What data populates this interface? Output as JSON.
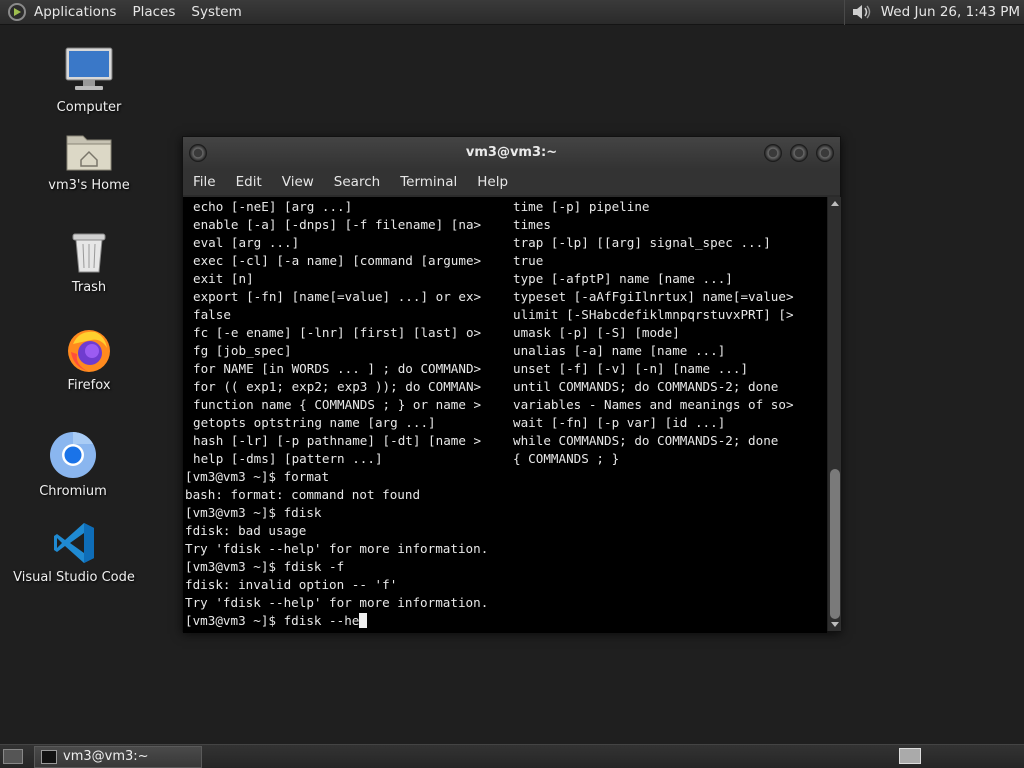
{
  "top_panel": {
    "menus": [
      "Applications",
      "Places",
      "System"
    ],
    "clock": "Wed Jun 26,  1:43 PM"
  },
  "desktop": {
    "icons": [
      {
        "label": "Computer",
        "icon": "computer-icon"
      },
      {
        "label": "vm3's Home",
        "icon": "home-folder-icon"
      },
      {
        "label": "Trash",
        "icon": "trash-icon"
      },
      {
        "label": "Firefox",
        "icon": "firefox-icon"
      },
      {
        "label": "Chromium",
        "icon": "chromium-icon"
      },
      {
        "label": "Visual Studio Code",
        "icon": "vscode-icon"
      }
    ]
  },
  "window": {
    "title": "vm3@vm3:~",
    "menus": [
      "File",
      "Edit",
      "View",
      "Search",
      "Terminal",
      "Help"
    ]
  },
  "terminal": {
    "left_column": [
      "echo [-neE] [arg ...]",
      "enable [-a] [-dnps] [-f filename] [na>",
      "eval [arg ...]",
      "exec [-cl] [-a name] [command [argume>",
      "exit [n]",
      "export [-fn] [name[=value] ...] or ex>",
      "false",
      "fc [-e ename] [-lnr] [first] [last] o>",
      "fg [job_spec]",
      "for NAME [in WORDS ... ] ; do COMMAND>",
      "for (( exp1; exp2; exp3 )); do COMMAN>",
      "function name { COMMANDS ; } or name >",
      "getopts optstring name [arg ...]",
      "hash [-lr] [-p pathname] [-dt] [name >",
      "help [-dms] [pattern ...]"
    ],
    "right_column": [
      "time [-p] pipeline",
      "times",
      "trap [-lp] [[arg] signal_spec ...]",
      "true",
      "type [-afptP] name [name ...]",
      "typeset [-aAfFgiIlnrtux] name[=value>",
      "ulimit [-SHabcdefiklmnpqrstuvxPRT] [>",
      "umask [-p] [-S] [mode]",
      "unalias [-a] name [name ...]",
      "unset [-f] [-v] [-n] [name ...]",
      "until COMMANDS; do COMMANDS-2; done",
      "variables - Names and meanings of so>",
      "wait [-fn] [-p var] [id ...]",
      "while COMMANDS; do COMMANDS-2; done",
      "{ COMMANDS ; }"
    ],
    "bottom_lines": [
      "[vm3@vm3 ~]$ format",
      "bash: format: command not found",
      "[vm3@vm3 ~]$ fdisk",
      "fdisk: bad usage",
      "Try 'fdisk --help' for more information.",
      "[vm3@vm3 ~]$ fdisk -f",
      "fdisk: invalid option -- 'f'",
      "Try 'fdisk --help' for more information."
    ],
    "current_input": "[vm3@vm3 ~]$ fdisk --he"
  },
  "bottom_panel": {
    "task": "vm3@vm3:~"
  }
}
